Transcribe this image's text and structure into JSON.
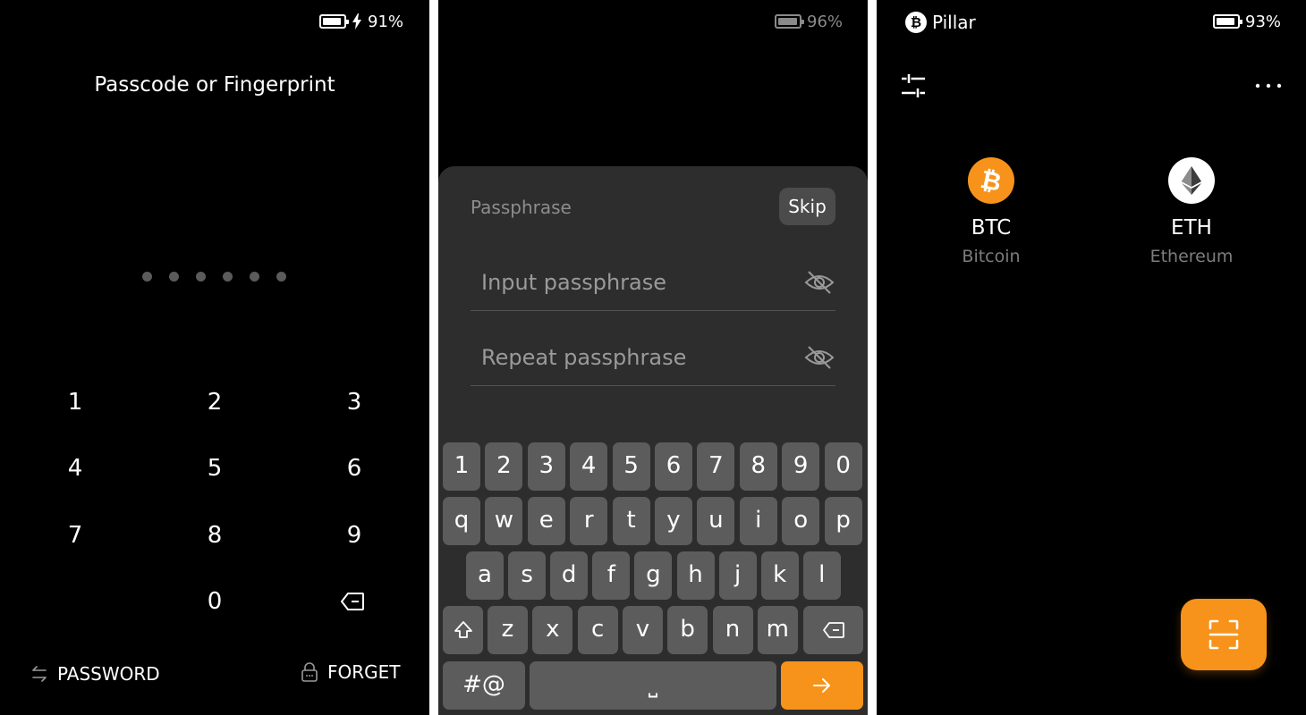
{
  "screen1": {
    "status": {
      "battery": "91%",
      "battery_level": 0.91,
      "charging": true
    },
    "title": "Passcode or Fingerprint",
    "passcode_dots": 6,
    "keypad": [
      "1",
      "2",
      "3",
      "4",
      "5",
      "6",
      "7",
      "8",
      "9",
      "0"
    ],
    "password_label": "PASSWORD",
    "forget_label": "FORGET"
  },
  "screen2": {
    "status": {
      "battery": "96%",
      "battery_level": 0.96
    },
    "sheet_title": "Passphrase",
    "skip_label": "Skip",
    "input_placeholder": "Input passphrase",
    "repeat_placeholder": "Repeat passphrase",
    "keyboard": {
      "row1": [
        "1",
        "2",
        "3",
        "4",
        "5",
        "6",
        "7",
        "8",
        "9",
        "0"
      ],
      "row2": [
        "q",
        "w",
        "e",
        "r",
        "t",
        "y",
        "u",
        "i",
        "o",
        "p"
      ],
      "row3": [
        "a",
        "s",
        "d",
        "f",
        "g",
        "h",
        "j",
        "k",
        "l"
      ],
      "row4": [
        "z",
        "x",
        "c",
        "v",
        "b",
        "n",
        "m"
      ],
      "symbols_label": "#@",
      "space_label": "⎵",
      "accent_color": "#f7931a"
    }
  },
  "screen3": {
    "status": {
      "battery": "93%",
      "battery_level": 0.93
    },
    "brand": "Pillar",
    "brand_logo": "₿",
    "coins": [
      {
        "symbol": "BTC",
        "name": "Bitcoin",
        "icon": "bitcoin-icon",
        "color": "#f7931a"
      },
      {
        "symbol": "ETH",
        "name": "Ethereum",
        "icon": "ethereum-icon",
        "color": "#ffffff"
      }
    ],
    "accent_color": "#f7931a"
  }
}
